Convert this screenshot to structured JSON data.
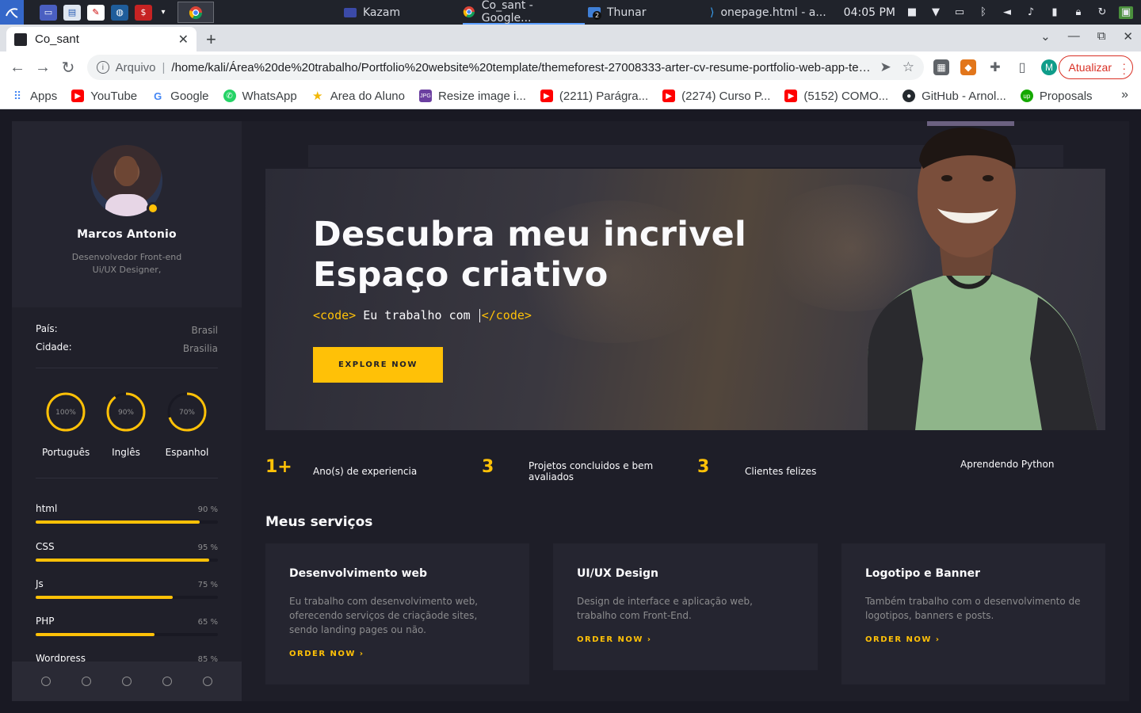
{
  "taskbar": {
    "tasks": [
      {
        "label": "Kazam"
      },
      {
        "label": "Co_sant - Google..."
      },
      {
        "label": "Thunar"
      },
      {
        "label": "onepage.html - a..."
      }
    ],
    "clock": "04:05 PM",
    "thunar_badge": "2"
  },
  "browser": {
    "tab_title": "Co_sant",
    "omnibox_scheme": "Arquivo",
    "omnibox_url": "/home/kali/Área%20de%20trabalho/Portfolio%20website%20template/themeforest-27008333-arter-cv-resume-portfolio-web-app-templat...",
    "profile_initial": "M",
    "update_label": "Atualizar",
    "bookmarks": [
      {
        "label": "Apps"
      },
      {
        "label": "YouTube"
      },
      {
        "label": "Google"
      },
      {
        "label": "WhatsApp"
      },
      {
        "label": "Area do Aluno"
      },
      {
        "label": "Resize image i..."
      },
      {
        "label": "(2211) Parágra..."
      },
      {
        "label": "(2274) Curso P..."
      },
      {
        "label": "(5152) COMO..."
      },
      {
        "label": "GitHub - Arnol..."
      },
      {
        "label": "Proposals"
      }
    ]
  },
  "sidebar": {
    "name": "Marcos Antonio",
    "role_line1": "Desenvolvedor Front-end",
    "role_line2": "Ui/UX Designer,",
    "info": [
      {
        "key": "País:",
        "value": "Brasil"
      },
      {
        "key": "Cidade:",
        "value": "Brasilia"
      }
    ],
    "languages": [
      {
        "name": "Português",
        "percent": 100,
        "label": "100%"
      },
      {
        "name": "Inglês",
        "percent": 90,
        "label": "90%"
      },
      {
        "name": "Espanhol",
        "percent": 70,
        "label": "70%"
      }
    ],
    "skills": [
      {
        "name": "html",
        "percent": 90,
        "label": "90 %"
      },
      {
        "name": "CSS",
        "percent": 95,
        "label": "95 %"
      },
      {
        "name": "Js",
        "percent": 75,
        "label": "75 %"
      },
      {
        "name": "PHP",
        "percent": 65,
        "label": "65 %"
      },
      {
        "name": "Wordpress",
        "percent": 85,
        "label": "85 %"
      }
    ]
  },
  "hero": {
    "title_line1": "Descubra meu incrivel",
    "title_line2": "Espaço criativo",
    "code_open": "<code>",
    "code_text": " Eu trabalho com ",
    "code_close": "</code>",
    "button": "EXPLORE NOW"
  },
  "stats": [
    {
      "number": "1+",
      "label": "Ano(s) de experiencia"
    },
    {
      "number": "3",
      "label": "Projetos concluidos e bem avaliados"
    },
    {
      "number": "3",
      "label": "Clientes felizes"
    },
    {
      "number": "",
      "label": "Aprendendo Python"
    }
  ],
  "services": {
    "title": "Meus serviços",
    "cards": [
      {
        "title": "Desenvolvimento web",
        "text": "Eu trabalho com desenvolvimento web, oferecendo serviços de criaçãode sites, sendo landing pages ou não.",
        "link": "ORDER NOW"
      },
      {
        "title": "UI/UX Design",
        "text": "Design de interface e aplicação web, trabalho com Front-End.",
        "link": "ORDER NOW"
      },
      {
        "title": "Logotipo e Banner",
        "text": "Também trabalho com o desenvolvimento de logotipos, banners e posts.",
        "link": "ORDER NOW"
      }
    ]
  },
  "colors": {
    "accent": "#ffc107",
    "bg": "#1e1e28",
    "card": "#252530"
  }
}
